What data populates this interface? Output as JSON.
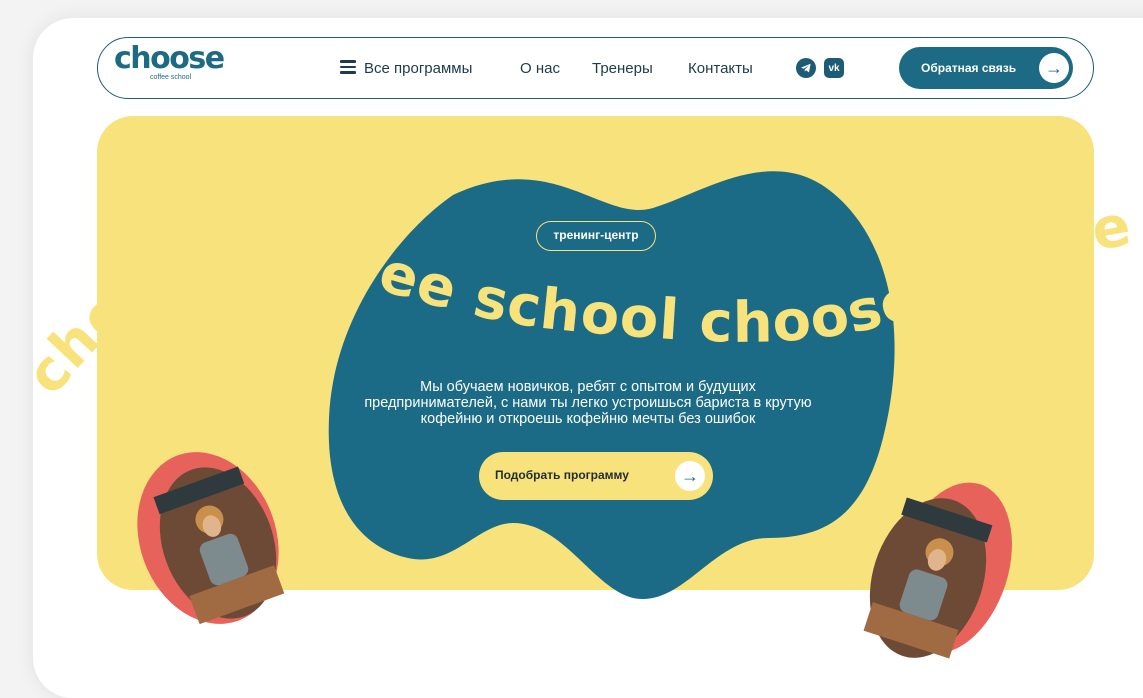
{
  "brand": {
    "name": "choose",
    "subtitle": "coffee school"
  },
  "nav": {
    "programs_label": "Все программы",
    "about_label": "О нас",
    "trainers_label": "Тренеры",
    "contacts_label": "Контакты"
  },
  "social": {
    "telegram_icon": "telegram-icon",
    "vk_icon": "vk-icon",
    "vk_text": "vk"
  },
  "header_cta": {
    "label": "Обратная связь",
    "arrow": "→"
  },
  "hero": {
    "badge": "тренинг-центр",
    "arc_text": "choose coffee school choose coffee",
    "description": "Мы обучаем новичков, ребят с опытом и будущих предпринимателей, с нами ты легко устроишься бариста в крутую кофейню и откроешь кофейню мечты без ошибок",
    "cta_label": "Подобрать программу",
    "cta_arrow": "→"
  },
  "colors": {
    "brand_blue": "#1d6a84",
    "hero_yellow": "#f8e27c",
    "accent_red": "#e8625c"
  }
}
